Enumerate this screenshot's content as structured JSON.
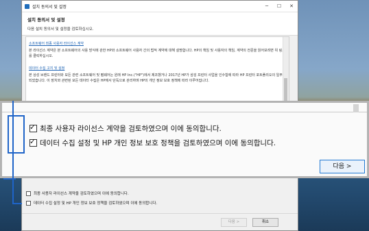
{
  "window": {
    "title": "설치 동의서 및 설정",
    "minimize": "─",
    "maximize": "☐",
    "close": "✕"
  },
  "header": {
    "title": "설치 동의서 및 설정",
    "subtitle": "다음 설치 동의서 및 설정을 검토하십시오."
  },
  "content": {
    "link1": "소프트웨어 최종 사용자 라이선스 계약",
    "para1": "본 라이선스 계약은 본 소프트웨어의 사용 방식에 관한 HP와 소프트웨어 사용자 간의 법적 계약에 대해 설명합니다. HP의 책임 및 사용자의 책임, 계약의 전문을 읽어보려면 위 링크를 클릭하십시오.",
    "link2": "데이터 수집 고지 및 설정",
    "para2": "본 상성 브랜드 프린터와 모든 관련 소프트웨어 및 펌웨어는 원래 HP Inc.(\"HP\")에서 제조했거나 2017년 HP가 삼성 프린터 사업을 인수함에 따라 HP 프린터 포트폴리오의 일부가 되었습니다. 이 장치와 관련된 모든 데이터 수집은 HP에서 단독으로 관리하며 HP의 개인 정보 보호 정책에 따라 이루어집니다."
  },
  "checkboxes": {
    "eula": "최종 사용자 라이선스 계약을 검토하였으며 이에 동의합니다.",
    "privacy": "데이터 수집 설정 및 HP 개인 정보 보호 정책을 검토하였으며 이에 동의합니다."
  },
  "buttons": {
    "next": "다음 >",
    "cancel": "취소"
  }
}
